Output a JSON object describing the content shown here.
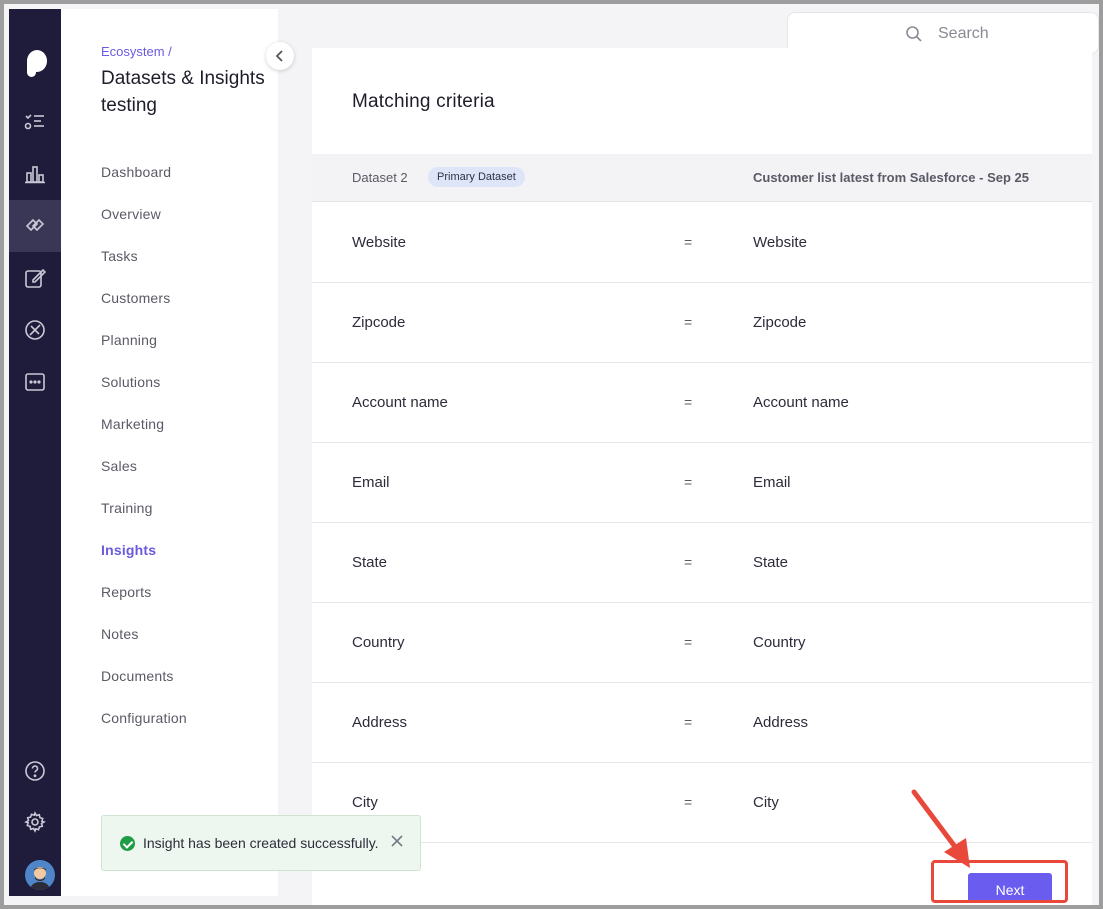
{
  "breadcrumb": "Ecosystem /",
  "page_title": "Datasets & Insights testing",
  "nav_items": [
    {
      "label": "Dashboard",
      "active": false
    },
    {
      "label": "Overview",
      "active": false
    },
    {
      "label": "Tasks",
      "active": false
    },
    {
      "label": "Customers",
      "active": false
    },
    {
      "label": "Planning",
      "active": false
    },
    {
      "label": "Solutions",
      "active": false
    },
    {
      "label": "Marketing",
      "active": false
    },
    {
      "label": "Sales",
      "active": false
    },
    {
      "label": "Training",
      "active": false
    },
    {
      "label": "Insights",
      "active": true
    },
    {
      "label": "Reports",
      "active": false
    },
    {
      "label": "Notes",
      "active": false
    },
    {
      "label": "Documents",
      "active": false
    },
    {
      "label": "Configuration",
      "active": false
    }
  ],
  "rail_icons": [
    "logo-icon",
    "checklist-icon",
    "bar-chart-icon",
    "ecosystem-icon",
    "edit-icon",
    "compass-icon",
    "more-icon",
    "help-icon",
    "settings-icon",
    "avatar"
  ],
  "search": {
    "placeholder": "Search"
  },
  "card": {
    "title": "Matching criteria",
    "left_header": "Dataset 2",
    "badge": "Primary Dataset",
    "right_header": "Customer list latest from Salesforce - Sep 25",
    "rows": [
      {
        "left": "Website",
        "op": "=",
        "right": "Website"
      },
      {
        "left": "Zipcode",
        "op": "=",
        "right": "Zipcode"
      },
      {
        "left": "Account name",
        "op": "=",
        "right": "Account name"
      },
      {
        "left": "Email",
        "op": "=",
        "right": "Email"
      },
      {
        "left": "State",
        "op": "=",
        "right": "State"
      },
      {
        "left": "Country",
        "op": "=",
        "right": "Country"
      },
      {
        "left": "Address",
        "op": "=",
        "right": "Address"
      },
      {
        "left": "City",
        "op": "=",
        "right": "City"
      }
    ]
  },
  "toast": {
    "message": "Insight has been created successfully."
  },
  "next_button": "Next",
  "colors": {
    "accent": "#6b5cf0",
    "rail": "#1f1b3a",
    "highlight": "#e8493a",
    "success": "#1f9d46"
  }
}
